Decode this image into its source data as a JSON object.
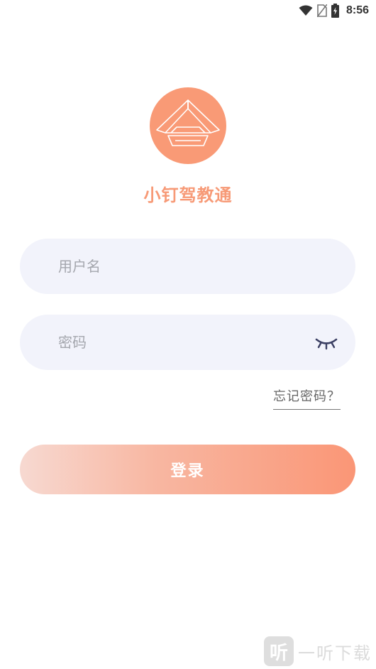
{
  "status_bar": {
    "time": "8:56",
    "icons": [
      "wifi-icon",
      "no-sim-icon",
      "battery-charging-icon"
    ]
  },
  "app": {
    "name": "小钉驾教通",
    "logo_color": "#f99a76"
  },
  "form": {
    "username_placeholder": "用户名",
    "password_placeholder": "密码",
    "forgot_password": "忘记密码？",
    "login_label": "登录"
  },
  "watermark": {
    "icon_char": "听",
    "text": "一听下载"
  },
  "colors": {
    "accent": "#f79a77",
    "field_bg": "#f2f3fb",
    "gradient_start": "#f7d9d1",
    "gradient_end": "#fa9676"
  }
}
